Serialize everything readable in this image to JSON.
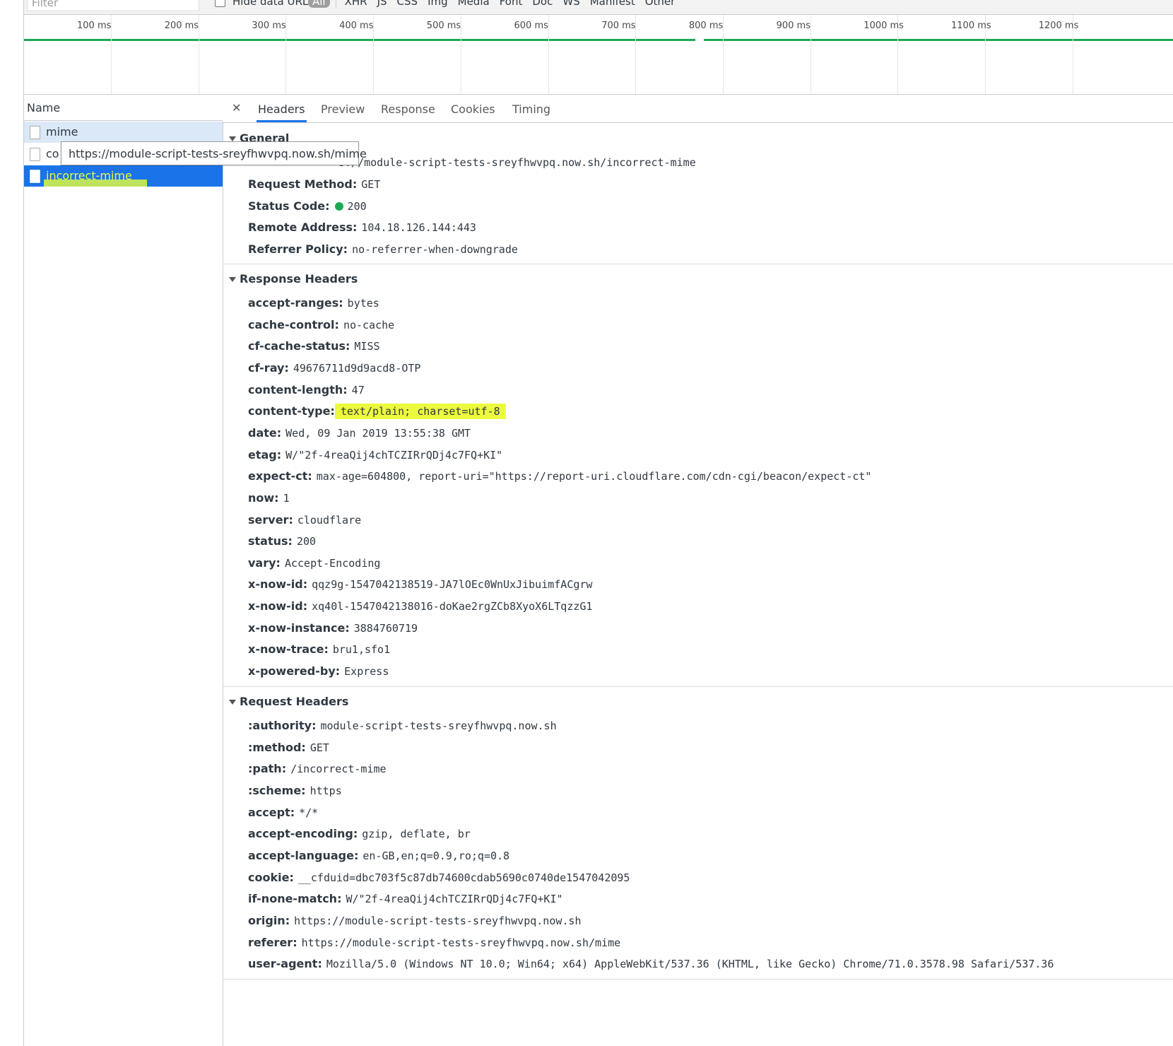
{
  "filter": {
    "placeholder": "Filter",
    "hide_data_urls": "Hide data URLs"
  },
  "type_filters": [
    "All",
    "XHR",
    "JS",
    "CSS",
    "Img",
    "Media",
    "Font",
    "Doc",
    "WS",
    "Manifest",
    "Other"
  ],
  "timeline": {
    "ticks": [
      "100 ms",
      "200 ms",
      "300 ms",
      "400 ms",
      "500 ms",
      "600 ms",
      "700 ms",
      "800 ms",
      "900 ms",
      "1000 ms",
      "1100 ms",
      "1200 ms"
    ],
    "bar_color": "#1aaa55"
  },
  "requests": {
    "header": "Name",
    "items": [
      {
        "name": "mime"
      },
      {
        "name": "co"
      },
      {
        "name": "incorrect-mime"
      }
    ],
    "tooltip": "https://module-script-tests-sreyfhwvpq.now.sh/mime"
  },
  "tabs": [
    "Headers",
    "Preview",
    "Response",
    "Cookies",
    "Timing"
  ],
  "general": {
    "title": "General",
    "request_url_tail": "s://module-script-tests-sreyfhwvpq.now.sh/incorrect-mime",
    "rows": [
      {
        "k": "Request Method:",
        "v": "GET"
      },
      {
        "k": "Status Code:",
        "v": "200"
      },
      {
        "k": "Remote Address:",
        "v": "104.18.126.144:443"
      },
      {
        "k": "Referrer Policy:",
        "v": "no-referrer-when-downgrade"
      }
    ]
  },
  "response_headers": {
    "title": "Response Headers",
    "rows": [
      {
        "k": "accept-ranges:",
        "v": "bytes"
      },
      {
        "k": "cache-control:",
        "v": "no-cache"
      },
      {
        "k": "cf-cache-status:",
        "v": "MISS"
      },
      {
        "k": "cf-ray:",
        "v": "49676711d9d9acd8-OTP"
      },
      {
        "k": "content-length:",
        "v": "47"
      },
      {
        "k": "content-type:",
        "v": "text/plain; charset=utf-8"
      },
      {
        "k": "date:",
        "v": "Wed, 09 Jan 2019 13:55:38 GMT"
      },
      {
        "k": "etag:",
        "v": "W/\"2f-4reaQij4chTCZIRrQDj4c7FQ+KI\""
      },
      {
        "k": "expect-ct:",
        "v": "max-age=604800, report-uri=\"https://report-uri.cloudflare.com/cdn-cgi/beacon/expect-ct\""
      },
      {
        "k": "now:",
        "v": "1"
      },
      {
        "k": "server:",
        "v": "cloudflare"
      },
      {
        "k": "status:",
        "v": "200"
      },
      {
        "k": "vary:",
        "v": "Accept-Encoding"
      },
      {
        "k": "x-now-id:",
        "v": "qqz9g-1547042138519-JA7lOEc0WnUxJibuimfACgrw"
      },
      {
        "k": "x-now-id:",
        "v": "xq40l-1547042138016-doKae2rgZCb8XyoX6LTqzzG1"
      },
      {
        "k": "x-now-instance:",
        "v": "3884760719"
      },
      {
        "k": "x-now-trace:",
        "v": "bru1,sfo1"
      },
      {
        "k": "x-powered-by:",
        "v": "Express"
      }
    ]
  },
  "request_headers": {
    "title": "Request Headers",
    "rows": [
      {
        "k": ":authority:",
        "v": "module-script-tests-sreyfhwvpq.now.sh"
      },
      {
        "k": ":method:",
        "v": "GET"
      },
      {
        "k": ":path:",
        "v": "/incorrect-mime"
      },
      {
        "k": ":scheme:",
        "v": "https"
      },
      {
        "k": "accept:",
        "v": "*/*"
      },
      {
        "k": "accept-encoding:",
        "v": "gzip, deflate, br"
      },
      {
        "k": "accept-language:",
        "v": "en-GB,en;q=0.9,ro;q=0.8"
      },
      {
        "k": "cookie:",
        "v": "__cfduid=dbc703f5c87db74600cdab5690c0740de1547042095"
      },
      {
        "k": "if-none-match:",
        "v": "W/\"2f-4reaQij4chTCZIRrQDj4c7FQ+KI\""
      },
      {
        "k": "origin:",
        "v": "https://module-script-tests-sreyfhwvpq.now.sh"
      },
      {
        "k": "referer:",
        "v": "https://module-script-tests-sreyfhwvpq.now.sh/mime"
      },
      {
        "k": "user-agent:",
        "v": "Mozilla/5.0 (Windows NT 10.0; Win64; x64) AppleWebKit/537.36 (KHTML, like Gecko) Chrome/71.0.3578.98 Safari/537.36"
      }
    ]
  },
  "colors": {
    "selected_bg": "#1a73e8",
    "highlight": "#ecfb3d",
    "status_ok": "#1aaa55"
  }
}
